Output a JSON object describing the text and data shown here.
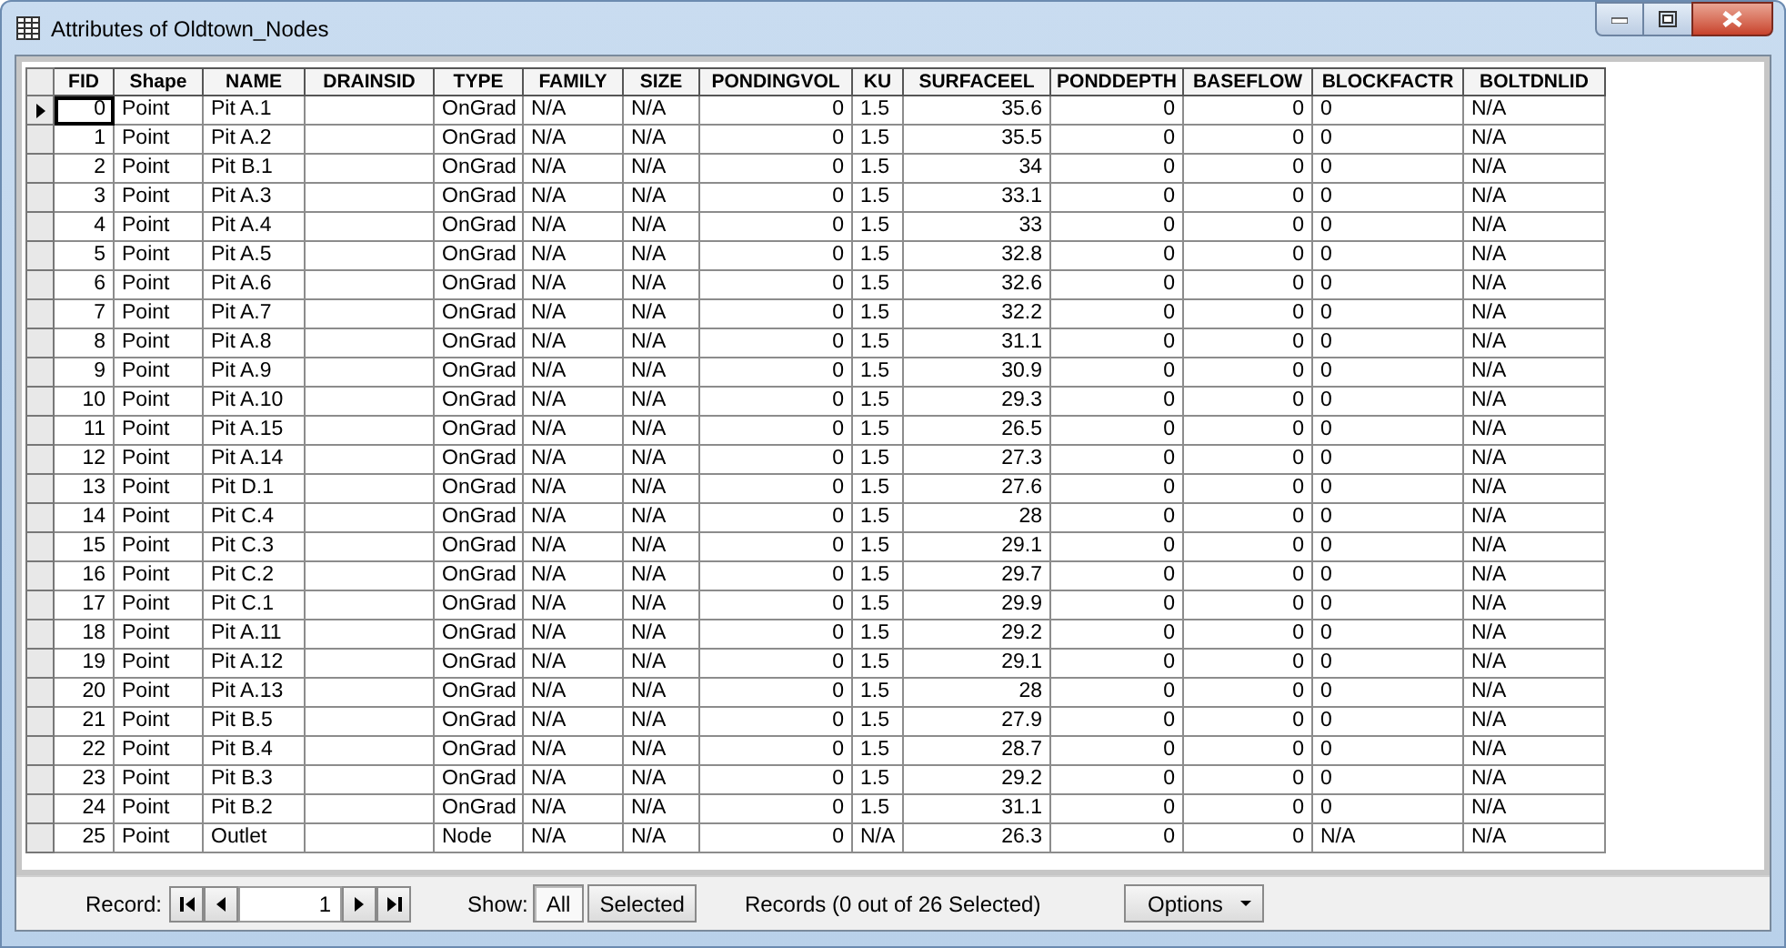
{
  "window": {
    "title": "Attributes of Oldtown_Nodes"
  },
  "table": {
    "columns": [
      {
        "label": "FID",
        "kind": "number"
      },
      {
        "label": "Shape",
        "kind": "text"
      },
      {
        "label": "NAME",
        "kind": "text"
      },
      {
        "label": "DRAINSID",
        "kind": "text"
      },
      {
        "label": "TYPE",
        "kind": "text"
      },
      {
        "label": "FAMILY",
        "kind": "text"
      },
      {
        "label": "SIZE",
        "kind": "text"
      },
      {
        "label": "PONDINGVOL",
        "kind": "number"
      },
      {
        "label": "KU",
        "kind": "text"
      },
      {
        "label": "SURFACEEL",
        "kind": "number"
      },
      {
        "label": "PONDDEPTH",
        "kind": "number"
      },
      {
        "label": "BASEFLOW",
        "kind": "number"
      },
      {
        "label": "BLOCKFACTR",
        "kind": "text"
      },
      {
        "label": "BOLTDNLID",
        "kind": "text"
      }
    ],
    "rows": [
      {
        "current": true,
        "cells": [
          "0",
          "Point",
          "Pit A.1",
          null,
          "OnGrad",
          "N/A",
          "N/A",
          "0",
          "1.5",
          "35.6",
          "0",
          "0",
          "0",
          "N/A"
        ]
      },
      {
        "current": false,
        "cells": [
          "1",
          "Point",
          "Pit A.2",
          null,
          "OnGrad",
          "N/A",
          "N/A",
          "0",
          "1.5",
          "35.5",
          "0",
          "0",
          "0",
          "N/A"
        ]
      },
      {
        "current": false,
        "cells": [
          "2",
          "Point",
          "Pit B.1",
          null,
          "OnGrad",
          "N/A",
          "N/A",
          "0",
          "1.5",
          "34",
          "0",
          "0",
          "0",
          "N/A"
        ]
      },
      {
        "current": false,
        "cells": [
          "3",
          "Point",
          "Pit A.3",
          null,
          "OnGrad",
          "N/A",
          "N/A",
          "0",
          "1.5",
          "33.1",
          "0",
          "0",
          "0",
          "N/A"
        ]
      },
      {
        "current": false,
        "cells": [
          "4",
          "Point",
          "Pit A.4",
          null,
          "OnGrad",
          "N/A",
          "N/A",
          "0",
          "1.5",
          "33",
          "0",
          "0",
          "0",
          "N/A"
        ]
      },
      {
        "current": false,
        "cells": [
          "5",
          "Point",
          "Pit A.5",
          null,
          "OnGrad",
          "N/A",
          "N/A",
          "0",
          "1.5",
          "32.8",
          "0",
          "0",
          "0",
          "N/A"
        ]
      },
      {
        "current": false,
        "cells": [
          "6",
          "Point",
          "Pit A.6",
          null,
          "OnGrad",
          "N/A",
          "N/A",
          "0",
          "1.5",
          "32.6",
          "0",
          "0",
          "0",
          "N/A"
        ]
      },
      {
        "current": false,
        "cells": [
          "7",
          "Point",
          "Pit A.7",
          null,
          "OnGrad",
          "N/A",
          "N/A",
          "0",
          "1.5",
          "32.2",
          "0",
          "0",
          "0",
          "N/A"
        ]
      },
      {
        "current": false,
        "cells": [
          "8",
          "Point",
          "Pit A.8",
          null,
          "OnGrad",
          "N/A",
          "N/A",
          "0",
          "1.5",
          "31.1",
          "0",
          "0",
          "0",
          "N/A"
        ]
      },
      {
        "current": false,
        "cells": [
          "9",
          "Point",
          "Pit A.9",
          null,
          "OnGrad",
          "N/A",
          "N/A",
          "0",
          "1.5",
          "30.9",
          "0",
          "0",
          "0",
          "N/A"
        ]
      },
      {
        "current": false,
        "cells": [
          "10",
          "Point",
          "Pit A.10",
          null,
          "OnGrad",
          "N/A",
          "N/A",
          "0",
          "1.5",
          "29.3",
          "0",
          "0",
          "0",
          "N/A"
        ]
      },
      {
        "current": false,
        "cells": [
          "11",
          "Point",
          "Pit A.15",
          null,
          "OnGrad",
          "N/A",
          "N/A",
          "0",
          "1.5",
          "26.5",
          "0",
          "0",
          "0",
          "N/A"
        ]
      },
      {
        "current": false,
        "cells": [
          "12",
          "Point",
          "Pit A.14",
          null,
          "OnGrad",
          "N/A",
          "N/A",
          "0",
          "1.5",
          "27.3",
          "0",
          "0",
          "0",
          "N/A"
        ]
      },
      {
        "current": false,
        "cells": [
          "13",
          "Point",
          "Pit D.1",
          null,
          "OnGrad",
          "N/A",
          "N/A",
          "0",
          "1.5",
          "27.6",
          "0",
          "0",
          "0",
          "N/A"
        ]
      },
      {
        "current": false,
        "cells": [
          "14",
          "Point",
          "Pit C.4",
          null,
          "OnGrad",
          "N/A",
          "N/A",
          "0",
          "1.5",
          "28",
          "0",
          "0",
          "0",
          "N/A"
        ]
      },
      {
        "current": false,
        "cells": [
          "15",
          "Point",
          "Pit C.3",
          null,
          "OnGrad",
          "N/A",
          "N/A",
          "0",
          "1.5",
          "29.1",
          "0",
          "0",
          "0",
          "N/A"
        ]
      },
      {
        "current": false,
        "cells": [
          "16",
          "Point",
          "Pit C.2",
          null,
          "OnGrad",
          "N/A",
          "N/A",
          "0",
          "1.5",
          "29.7",
          "0",
          "0",
          "0",
          "N/A"
        ]
      },
      {
        "current": false,
        "cells": [
          "17",
          "Point",
          "Pit C.1",
          null,
          "OnGrad",
          "N/A",
          "N/A",
          "0",
          "1.5",
          "29.9",
          "0",
          "0",
          "0",
          "N/A"
        ]
      },
      {
        "current": false,
        "cells": [
          "18",
          "Point",
          "Pit A.11",
          null,
          "OnGrad",
          "N/A",
          "N/A",
          "0",
          "1.5",
          "29.2",
          "0",
          "0",
          "0",
          "N/A"
        ]
      },
      {
        "current": false,
        "cells": [
          "19",
          "Point",
          "Pit A.12",
          null,
          "OnGrad",
          "N/A",
          "N/A",
          "0",
          "1.5",
          "29.1",
          "0",
          "0",
          "0",
          "N/A"
        ]
      },
      {
        "current": false,
        "cells": [
          "20",
          "Point",
          "Pit A.13",
          null,
          "OnGrad",
          "N/A",
          "N/A",
          "0",
          "1.5",
          "28",
          "0",
          "0",
          "0",
          "N/A"
        ]
      },
      {
        "current": false,
        "cells": [
          "21",
          "Point",
          "Pit B.5",
          null,
          "OnGrad",
          "N/A",
          "N/A",
          "0",
          "1.5",
          "27.9",
          "0",
          "0",
          "0",
          "N/A"
        ]
      },
      {
        "current": false,
        "cells": [
          "22",
          "Point",
          "Pit B.4",
          null,
          "OnGrad",
          "N/A",
          "N/A",
          "0",
          "1.5",
          "28.7",
          "0",
          "0",
          "0",
          "N/A"
        ]
      },
      {
        "current": false,
        "cells": [
          "23",
          "Point",
          "Pit B.3",
          null,
          "OnGrad",
          "N/A",
          "N/A",
          "0",
          "1.5",
          "29.2",
          "0",
          "0",
          "0",
          "N/A"
        ]
      },
      {
        "current": false,
        "cells": [
          "24",
          "Point",
          "Pit B.2",
          null,
          "OnGrad",
          "N/A",
          "N/A",
          "0",
          "1.5",
          "31.1",
          "0",
          "0",
          "0",
          "N/A"
        ]
      },
      {
        "current": false,
        "cells": [
          "25",
          "Point",
          "Outlet",
          null,
          "Node",
          "N/A",
          "N/A",
          "0",
          "N/A",
          "26.3",
          "0",
          "0",
          "N/A",
          "N/A"
        ]
      }
    ]
  },
  "toolbar": {
    "record_label": "Record:",
    "record_value": "1",
    "show_label": "Show:",
    "show_buttons": [
      {
        "label": "All",
        "selected": true
      },
      {
        "label": "Selected",
        "selected": false
      }
    ],
    "status": "Records (0 out of 26 Selected)",
    "options": "Options"
  }
}
